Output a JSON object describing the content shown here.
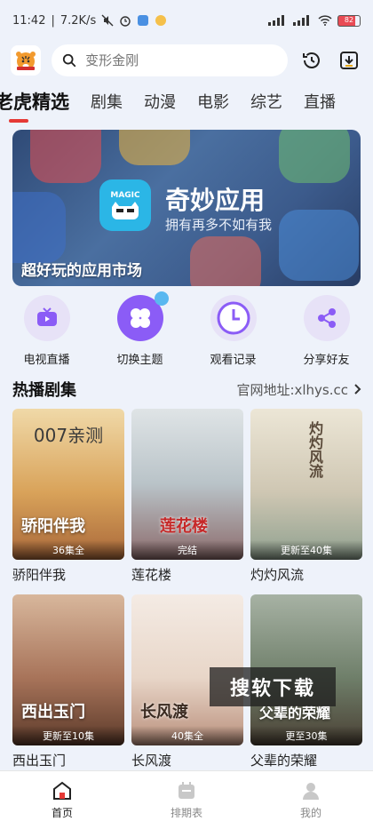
{
  "status": {
    "time": "11:42",
    "speed": "7.2K/s",
    "battery": "82"
  },
  "search": {
    "placeholder": "变形金刚"
  },
  "tabs": [
    "老虎精选",
    "剧集",
    "动漫",
    "电影",
    "综艺",
    "直播"
  ],
  "banner": {
    "app_badge": "MAGIC",
    "title": "奇妙应用",
    "subtitle": "拥有再多不如有我",
    "caption": "超好玩的应用市场"
  },
  "quick": [
    {
      "label": "电视直播",
      "icon": "tv-icon",
      "color": "#8b5cf6"
    },
    {
      "label": "切换主题",
      "icon": "theme-icon",
      "color": "#8b5cf6"
    },
    {
      "label": "观看记录",
      "icon": "clock-icon",
      "color": "#8b5cf6"
    },
    {
      "label": "分享好友",
      "icon": "share-icon",
      "color": "#8b5cf6"
    }
  ],
  "section": {
    "title": "热播剧集",
    "link": "官网地址:xlhys.cc"
  },
  "cards": [
    {
      "title": "骄阳伴我",
      "badge": "36集全",
      "poster_top": "007亲测",
      "poster_text": "骄阳伴我",
      "color": "#d9a35a"
    },
    {
      "title": "莲花楼",
      "badge": "完结",
      "poster_top": "",
      "poster_text": "莲花楼",
      "color": "#b9c3c8"
    },
    {
      "title": "灼灼风流",
      "badge": "更新至40集",
      "poster_top": "",
      "poster_text": "灼灼风流",
      "color": "#cfc7b3"
    },
    {
      "title": "西出玉门",
      "badge": "更新至10集",
      "poster_top": "",
      "poster_text": "西出玉门",
      "color": "#a8745a"
    },
    {
      "title": "长风渡",
      "badge": "40集全",
      "poster_top": "",
      "poster_text": "长风渡",
      "color": "#e8d6c8"
    },
    {
      "title": "父辈的荣耀",
      "badge": "更至30集",
      "poster_top": "",
      "poster_text": "父辈的荣耀",
      "color": "#6f7f6a"
    }
  ],
  "watermark": "搜软下载",
  "nav": [
    {
      "label": "首页",
      "icon": "home-icon",
      "active": true
    },
    {
      "label": "排期表",
      "icon": "calendar-icon",
      "active": false
    },
    {
      "label": "我的",
      "icon": "user-icon",
      "active": false
    }
  ]
}
